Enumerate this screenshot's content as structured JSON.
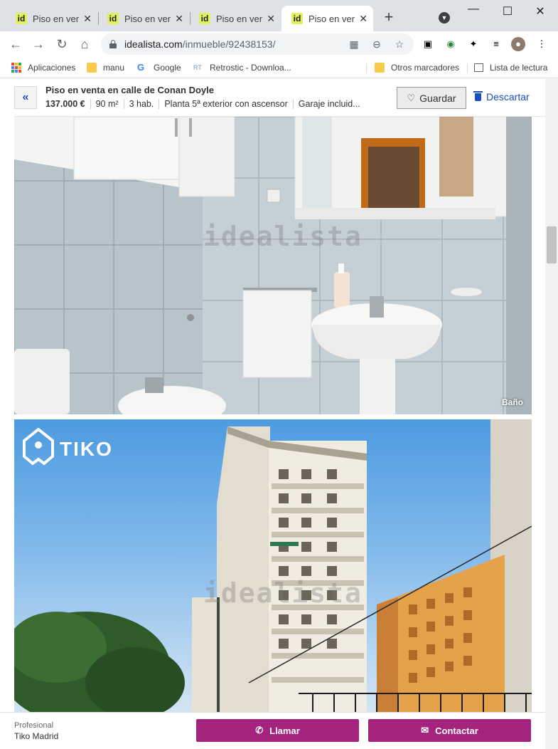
{
  "browser": {
    "tabs": [
      {
        "favicon": "id",
        "title": "Piso en venta"
      },
      {
        "favicon": "id",
        "title": "Piso en venta"
      },
      {
        "favicon": "id",
        "title": "Piso en venta"
      },
      {
        "favicon": "id",
        "title": "Piso en venta"
      }
    ],
    "new_tab": "+",
    "url_domain": "idealista.com",
    "url_path": "/inmueble/92438153/",
    "bookmarks": [
      {
        "label": "Aplicaciones",
        "icon": "apps-icon"
      },
      {
        "label": "manu",
        "icon": "folder-icon"
      },
      {
        "label": "Google",
        "icon": "google-icon"
      },
      {
        "label": "Retrostic - Downloa...",
        "icon": "retrostic-icon"
      }
    ],
    "bookmarks_right": [
      {
        "label": "Otros marcadores",
        "icon": "folder-icon"
      },
      {
        "label": "Lista de lectura",
        "icon": "reading-list-icon"
      }
    ]
  },
  "listing": {
    "back": "«",
    "title": "Piso en venta en calle de Conan Doyle",
    "price": "137.000 €",
    "area": "90 m²",
    "rooms": "3 hab.",
    "floor": "Planta 5ª exterior con ascensor",
    "garage": "Garaje incluid...",
    "save_label": "Guardar",
    "discard_label": "Descartar"
  },
  "photos": {
    "photo1_caption": "Baño",
    "watermark": "idealista",
    "brand_logo": "TIKO"
  },
  "footer": {
    "pro_label": "Profesional",
    "pro_name": "Tiko Madrid",
    "call_label": "Llamar",
    "contact_label": "Contactar"
  },
  "colors": {
    "brand_magenta": "#a3237e",
    "link_blue": "#1a4fc2",
    "favicon_yellow": "#e1f05b"
  }
}
